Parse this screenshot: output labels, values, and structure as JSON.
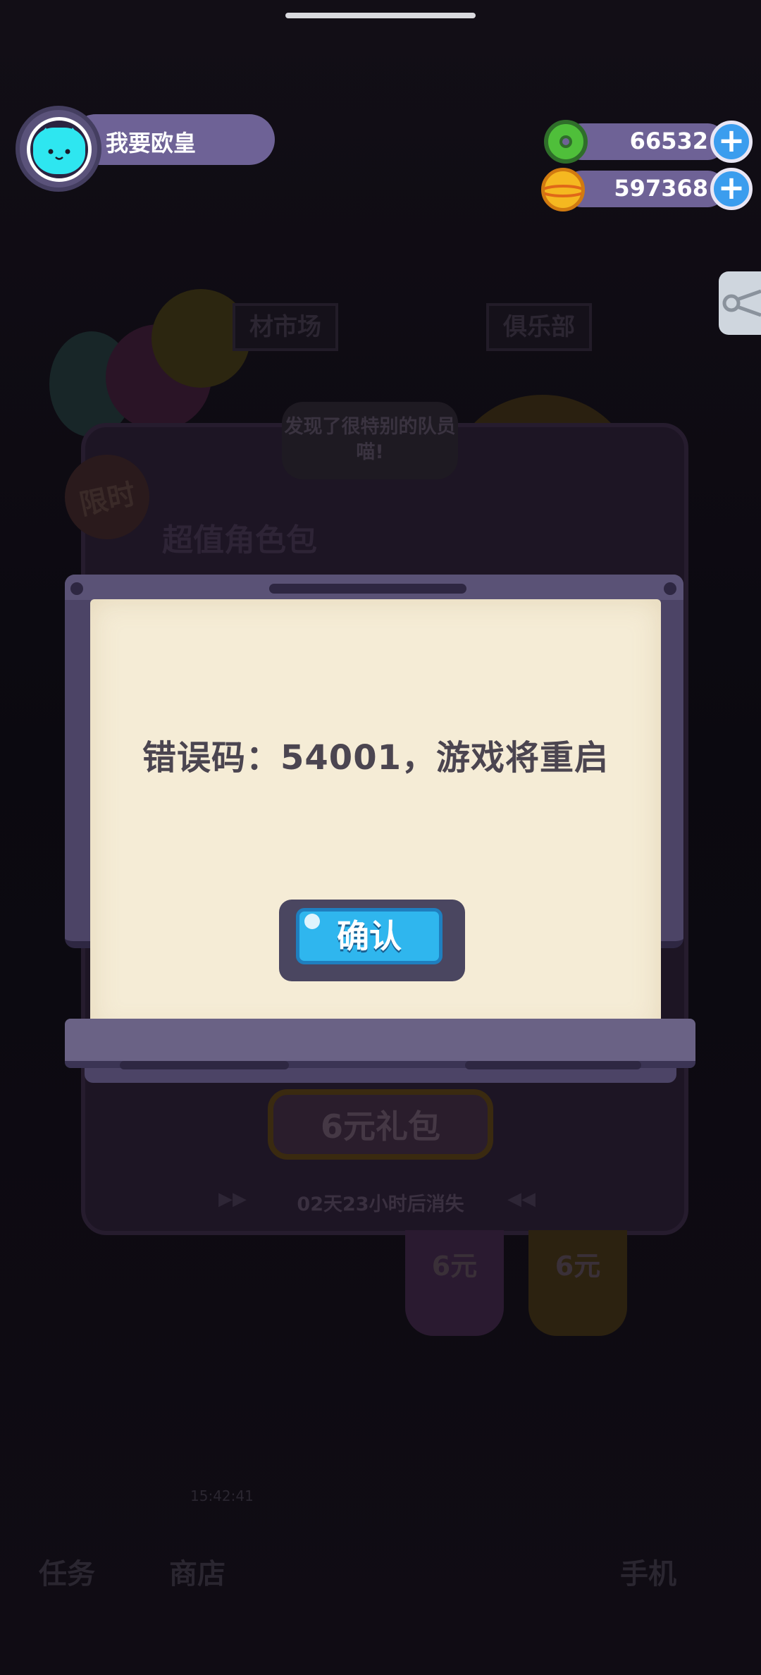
{
  "profile": {
    "name": "我要欧皇"
  },
  "resources": [
    {
      "icon": "donut-icon",
      "value": "66532"
    },
    {
      "icon": "gold-planet-coin-icon",
      "value": "597368"
    }
  ],
  "dialog": {
    "message": "错误码：54001，游戏将重启",
    "confirm_label": "确认"
  },
  "background": {
    "limited_badge": "限时",
    "pack_title": "超值角色包",
    "bubble_text": "发现了很特别的队员喵!",
    "sign_left": "材市场",
    "sign_right": "俱乐部",
    "gift_button": "6元礼包",
    "countdown": "02天23小时后消失",
    "price_options": [
      "6元",
      "6元"
    ],
    "nav_tasks": "任务",
    "nav_shop": "商店",
    "nav_phone": "手机",
    "timer": "15:42:41"
  },
  "colors": {
    "accent": "#2fb6ee",
    "paper": "#f5ecd6",
    "frame": "#4c4466",
    "resource_bar": "#6e6296"
  }
}
